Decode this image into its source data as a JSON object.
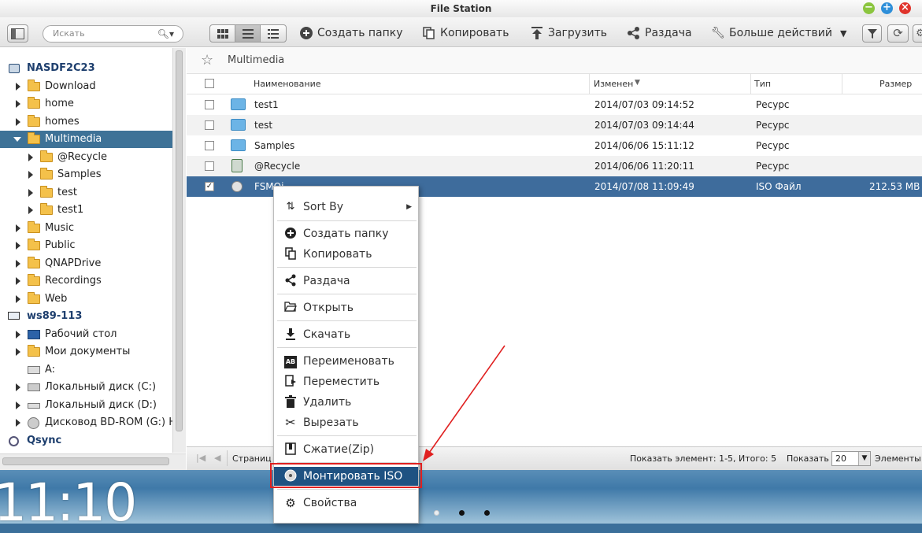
{
  "window": {
    "title": "File Station"
  },
  "colors": {
    "accent": "#3e7297",
    "selection": "#3e6c9c",
    "highlight_box": "#e02020",
    "annotation_arrow": "#e02020"
  },
  "toolbar": {
    "search_placeholder": "Искать",
    "create_folder": "Создать папку",
    "copy": "Копировать",
    "upload": "Загрузить",
    "share": "Раздача",
    "more_actions": "Больше действий"
  },
  "sidebar": {
    "nas_name": "NASDF2C23",
    "nas_items": [
      {
        "label": "Download"
      },
      {
        "label": "home"
      },
      {
        "label": "homes"
      },
      {
        "label": "Multimedia"
      },
      {
        "label": "@Recycle"
      },
      {
        "label": "Samples"
      },
      {
        "label": "test"
      },
      {
        "label": "test1"
      },
      {
        "label": "Music"
      },
      {
        "label": "Public"
      },
      {
        "label": "QNAPDrive"
      },
      {
        "label": "Recordings"
      },
      {
        "label": "Web"
      }
    ],
    "pc_name": "ws89-113",
    "pc_items": [
      {
        "label": "Рабочий стол"
      },
      {
        "label": "Мои документы"
      },
      {
        "label": "A:"
      },
      {
        "label": "Локальный диск (C:)"
      },
      {
        "label": "Локальный диск (D:)"
      },
      {
        "label": "Дисковод BD-ROM (G:) Ho"
      }
    ],
    "qsync_name": "Qsync"
  },
  "path": {
    "current": "Multimedia"
  },
  "table": {
    "headers": {
      "name": "Наименование",
      "modified": "Изменен",
      "type": "Тип",
      "size": "Размер"
    },
    "rows": [
      {
        "name": "test1",
        "modified": "2014/07/03 09:14:52",
        "type": "Ресурс",
        "size": ""
      },
      {
        "name": "test",
        "modified": "2014/07/03 09:14:44",
        "type": "Ресурс",
        "size": ""
      },
      {
        "name": "Samples",
        "modified": "2014/06/06 15:11:12",
        "type": "Ресурс",
        "size": ""
      },
      {
        "name": "@Recycle",
        "modified": "2014/06/06 11:20:11",
        "type": "Ресурс",
        "size": ""
      },
      {
        "name": "FSMOi",
        "modified": "2014/07/08 11:09:49",
        "type": "ISO Файл",
        "size": "212.53 MB"
      }
    ]
  },
  "status": {
    "page_label": "Страниц",
    "shown": "Показать элемент: 1-5, Итого: 5",
    "show_label": "Показать",
    "per_page": "20",
    "items_label": "Элементы"
  },
  "context_menu": {
    "sort_by": "Sort By",
    "create_folder": "Создать папку",
    "copy": "Копировать",
    "share": "Раздача",
    "open": "Открыть",
    "download": "Скачать",
    "rename": "Переименовать",
    "move": "Переместить",
    "delete": "Удалить",
    "cut": "Вырезать",
    "compress": "Сжатие(Zip)",
    "mount_iso": "Монтировать ISO",
    "properties": "Свойства"
  },
  "desktop": {
    "clock": "11:10"
  }
}
